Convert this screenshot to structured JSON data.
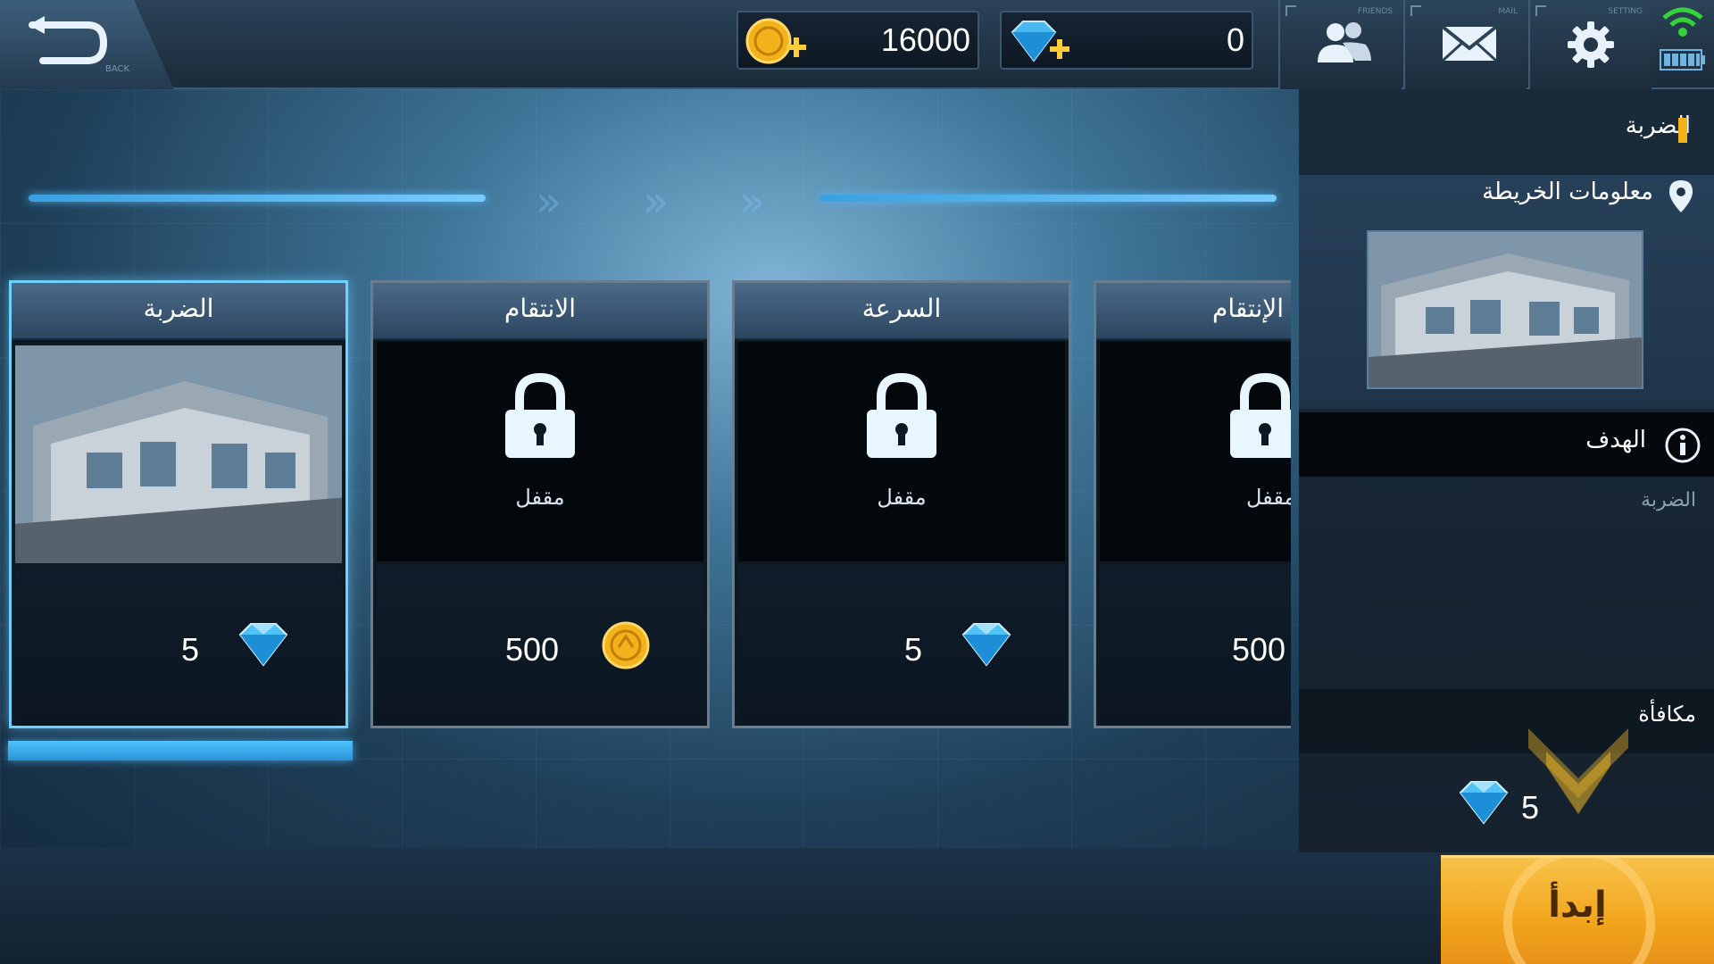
{
  "topbar": {
    "back_hint": "BACK",
    "gold": "16000",
    "diamonds": "0",
    "friends_tiny": "FRIENDS",
    "mail_tiny": "MAIL",
    "settings_tiny": "SETTING"
  },
  "cards": [
    {
      "title": "الضربة",
      "state": "unlocked",
      "price": "5",
      "currency": "diamond"
    },
    {
      "title": "الانتقام",
      "state": "locked",
      "lock_label": "مقفل",
      "price": "500",
      "currency": "gold"
    },
    {
      "title": "السرعة",
      "state": "locked",
      "lock_label": "مقفل",
      "price": "5",
      "currency": "diamond"
    },
    {
      "title": "الإنتقام",
      "state": "locked",
      "lock_label": "مقفل",
      "price": "500",
      "currency": "gold"
    }
  ],
  "right_panel": {
    "mode_title": "الضربة",
    "map_info_label": "معلومات الخريطة",
    "goal_label": "الهدف",
    "goal_text": "الضربة",
    "reward_label": "مكافأة",
    "reward_value": "5"
  },
  "start_button": {
    "label": "إبدأ"
  },
  "colors": {
    "accent_blue": "#6ed0ff",
    "gold": "#f5b21b",
    "start_orange": "#f2a51c"
  }
}
